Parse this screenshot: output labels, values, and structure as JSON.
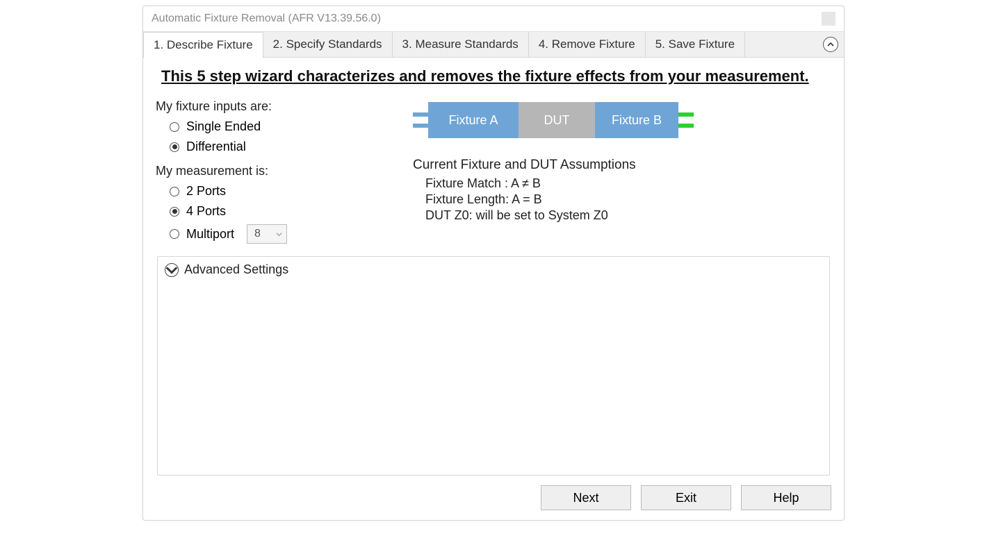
{
  "window": {
    "title": "Automatic Fixture Removal (AFR V13.39.56.0)"
  },
  "tabs": [
    {
      "label": "1. Describe Fixture",
      "active": true
    },
    {
      "label": "2. Specify Standards",
      "active": false
    },
    {
      "label": "3. Measure Standards",
      "active": false
    },
    {
      "label": "4. Remove Fixture",
      "active": false
    },
    {
      "label": "5. Save Fixture",
      "active": false
    }
  ],
  "headline": "This 5 step wizard characterizes and removes the fixture effects from your measurement.",
  "fixtureInputs": {
    "label": "My fixture inputs are:",
    "options": {
      "single": "Single Ended",
      "diff": "Differential"
    },
    "selected": "diff"
  },
  "measurement": {
    "label": "My measurement is:",
    "options": {
      "two": "2 Ports",
      "four": "4 Ports",
      "multi": "Multiport"
    },
    "selected": "four",
    "multiportValue": "8"
  },
  "diagram": {
    "fixA": "Fixture A",
    "dut": "DUT",
    "fixB": "Fixture B"
  },
  "assumptions": {
    "title": "Current Fixture and DUT Assumptions",
    "lines": [
      "Fixture Match : A ≠ B",
      "Fixture Length: A = B",
      "DUT Z0: will be set to System Z0"
    ]
  },
  "advanced": {
    "label": "Advanced Settings"
  },
  "footer": {
    "next": "Next",
    "exit": "Exit",
    "help": "Help"
  }
}
